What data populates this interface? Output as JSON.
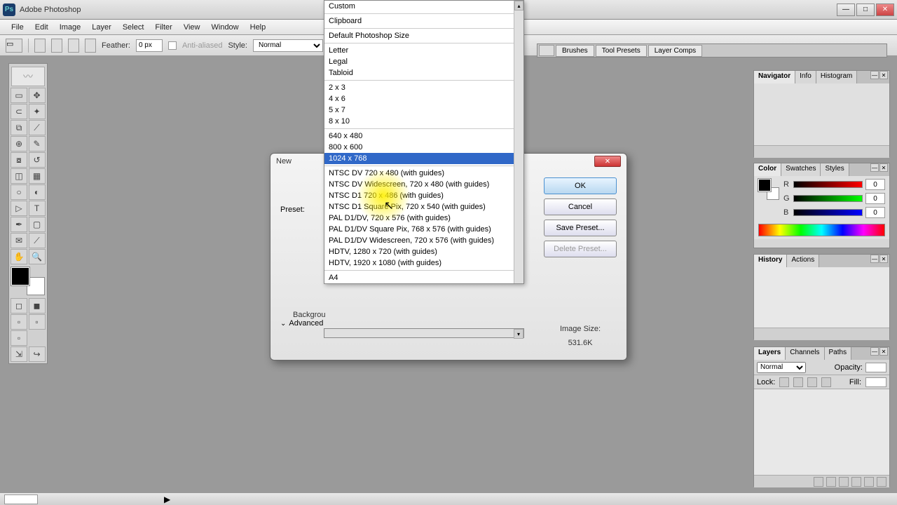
{
  "app": {
    "title": "Adobe Photoshop"
  },
  "menus": [
    "File",
    "Edit",
    "Image",
    "Layer",
    "Select",
    "Filter",
    "View",
    "Window",
    "Help"
  ],
  "options": {
    "feather_label": "Feather:",
    "feather_value": "0 px",
    "antialiased": "Anti-aliased",
    "style_label": "Style:",
    "style_value": "Normal"
  },
  "dock": {
    "tabs": [
      "Brushes",
      "Tool Presets",
      "Layer Comps"
    ]
  },
  "panels": {
    "nav": {
      "tabs": [
        "Navigator",
        "Info",
        "Histogram"
      ]
    },
    "color": {
      "tabs": [
        "Color",
        "Swatches",
        "Styles"
      ],
      "r_label": "R",
      "g_label": "G",
      "b_label": "B",
      "r_val": "0",
      "g_val": "0",
      "b_val": "0"
    },
    "history": {
      "tabs": [
        "History",
        "Actions"
      ]
    },
    "layers": {
      "tabs": [
        "Layers",
        "Channels",
        "Paths"
      ],
      "blend": "Normal",
      "opacity_label": "Opacity:",
      "lock_label": "Lock:",
      "fill_label": "Fill:"
    }
  },
  "dialog": {
    "title": "New",
    "preset_label": "Preset:",
    "background_label": "Backgrou",
    "advanced": "Advanced",
    "ok": "OK",
    "cancel": "Cancel",
    "save_preset": "Save Preset...",
    "delete_preset": "Delete Preset...",
    "image_size_label": "Image Size:",
    "image_size_value": "531.6K"
  },
  "presets": {
    "groups": [
      [
        "Custom"
      ],
      [
        "Clipboard"
      ],
      [
        "Default Photoshop Size"
      ],
      [
        "Letter",
        "Legal",
        "Tabloid"
      ],
      [
        "2 x 3",
        "4 x 6",
        "5 x 7",
        "8 x 10"
      ],
      [
        "640 x 480",
        "800 x 600",
        "1024 x 768"
      ],
      [
        "NTSC DV 720 x 480 (with guides)",
        "NTSC DV Widescreen, 720 x 480 (with guides)",
        "NTSC D1 720 x 486 (with guides)",
        "NTSC D1 Square Pix, 720 x 540 (with guides)",
        "PAL D1/DV, 720 x 576 (with guides)",
        "PAL D1/DV Square Pix, 768 x 576 (with guides)",
        "PAL D1/DV Widescreen, 720 x 576 (with guides)",
        "HDTV, 1280 x 720 (with guides)",
        "HDTV, 1920 x 1080 (with guides)"
      ],
      [
        "A4"
      ]
    ],
    "selected": "1024 x 768"
  }
}
